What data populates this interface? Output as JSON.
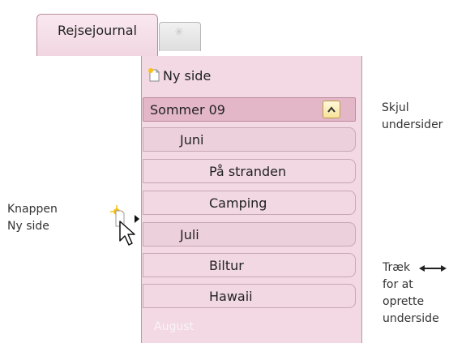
{
  "tabs": {
    "active_label": "Rejsejournal",
    "new_tab_icon": "sparkle-icon"
  },
  "new_page": {
    "label": "Ny side"
  },
  "pages": [
    {
      "label": "Sommer 09",
      "level": 0
    },
    {
      "label": "Juni",
      "level": 1
    },
    {
      "label": "På stranden",
      "level": 2
    },
    {
      "label": "Camping",
      "level": 2
    },
    {
      "label": "Juli",
      "level": 1
    },
    {
      "label": "Biltur",
      "level": 2
    },
    {
      "label": "Hawaii",
      "level": 2
    }
  ],
  "faded_item": "August",
  "callouts": {
    "hide_line1": "Skjul",
    "hide_line2": "undersider",
    "button_line1": "Knappen",
    "button_line2": "Ny side",
    "drag_line1": "Træk",
    "drag_line2": "for at",
    "drag_line3": "oprette",
    "drag_line4": "underside"
  },
  "colors": {
    "tab_border": "#b88a9c",
    "pane": "#f2d9e3",
    "group_header": "#e3b7c8",
    "subpage": "#f1d8e2",
    "collapse_button": "#f7e39a"
  }
}
